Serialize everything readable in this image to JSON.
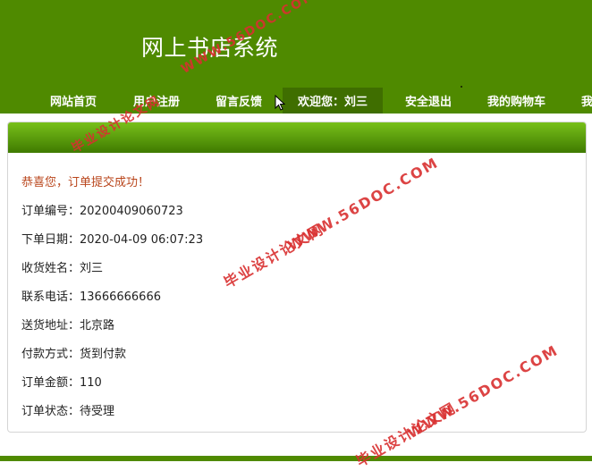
{
  "header": {
    "site_title": "网上书店系统"
  },
  "nav": {
    "items": [
      {
        "label": "网站首页"
      },
      {
        "label": "用户注册"
      },
      {
        "label": "留言反馈"
      },
      {
        "label": "欢迎您：刘三"
      },
      {
        "label": "安全退出"
      },
      {
        "label": "我的购物车"
      },
      {
        "label": "我"
      }
    ]
  },
  "order": {
    "success_message": "恭喜您，订单提交成功！",
    "fields": [
      {
        "label": "订单编号：",
        "value": "20200409060723"
      },
      {
        "label": "下单日期：",
        "value": "2020-04-09 06:07:23"
      },
      {
        "label": "收货姓名：",
        "value": "刘三"
      },
      {
        "label": "联系电话：",
        "value": "13666666666"
      },
      {
        "label": "送货地址：",
        "value": "北京路"
      },
      {
        "label": "付款方式：",
        "value": "货到付款"
      },
      {
        "label": "订单金额：",
        "value": "110"
      },
      {
        "label": "订单状态：",
        "value": "待受理"
      }
    ]
  },
  "watermark": {
    "url": "WWW.56DOC.COM",
    "name": "毕业设计论文网"
  },
  "colors": {
    "header_green": "#4f8a00",
    "active_nav": "#3f6e00",
    "success_text": "#b9451b",
    "watermark": "#d93030"
  }
}
